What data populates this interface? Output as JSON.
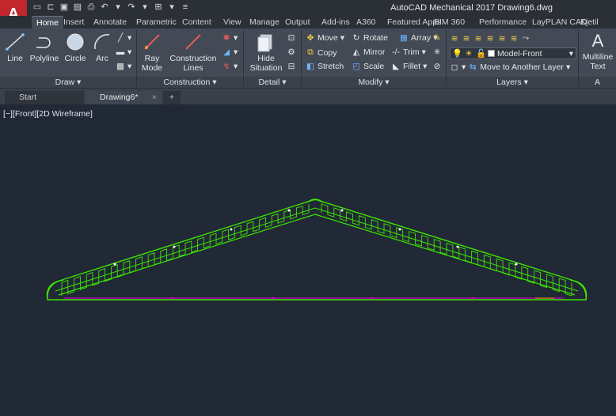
{
  "app": {
    "logo": "A",
    "title": "AutoCAD Mechanical 2017   Drawing6.dwg"
  },
  "ribbon_tabs": [
    "Home",
    "Insert",
    "Annotate",
    "Parametric",
    "Content",
    "View",
    "Manage",
    "Output",
    "Add-ins",
    "A360",
    "Featured Apps",
    "BIM 360",
    "Performance",
    "LayPLAN CAD",
    "Kjetil"
  ],
  "draw": {
    "line": "Line",
    "polyline": "Polyline",
    "circle": "Circle",
    "arc": "Arc",
    "panel": "Draw ▾"
  },
  "construction": {
    "ray": "Ray",
    "mode": "Mode",
    "lines": "Construction",
    "lines2": "Lines",
    "panel": "Construction ▾"
  },
  "detail": {
    "hide": "Hide",
    "situation": "Situation",
    "panel": "Detail ▾"
  },
  "modify": {
    "move": "Move",
    "rotate": "Rotate",
    "array": "Array",
    "copy": "Copy",
    "mirror": "Mirror",
    "trim": "Trim",
    "stretch": "Stretch",
    "scale": "Scale",
    "fillet": "Fillet",
    "panel": "Modify ▾"
  },
  "layers": {
    "current_layer": "Model-Front",
    "move_to_layer": "Move to Another Layer",
    "panel": "Layers ▾"
  },
  "annotation": {
    "multiline": "Multiline",
    "text": "Text",
    "panel": "A"
  },
  "file_tabs": {
    "start": "Start",
    "doc": "Drawing6*",
    "close": "×",
    "new": "+"
  },
  "viewport": {
    "label": "[−][Front][2D Wireframe]"
  },
  "colors": {
    "truss": "#3ee600",
    "baseline": "#c800c8",
    "accent_tab": "#6a7280"
  }
}
